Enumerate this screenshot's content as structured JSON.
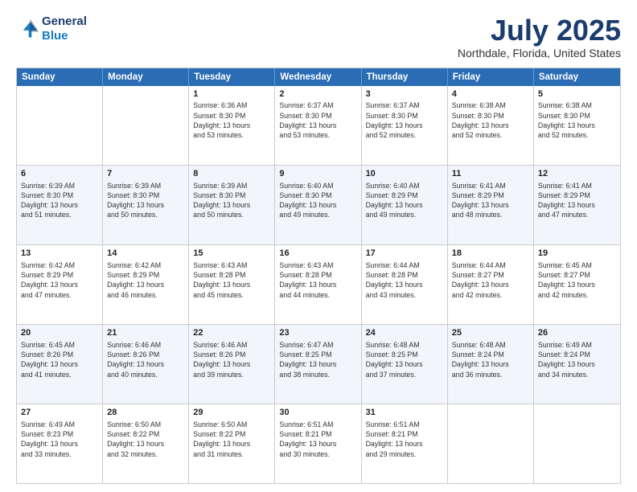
{
  "logo": {
    "line1": "General",
    "line2": "Blue"
  },
  "title": "July 2025",
  "location": "Northdale, Florida, United States",
  "weekdays": [
    "Sunday",
    "Monday",
    "Tuesday",
    "Wednesday",
    "Thursday",
    "Friday",
    "Saturday"
  ],
  "rows": [
    [
      {
        "day": "",
        "info": ""
      },
      {
        "day": "",
        "info": ""
      },
      {
        "day": "1",
        "info": "Sunrise: 6:36 AM\nSunset: 8:30 PM\nDaylight: 13 hours\nand 53 minutes."
      },
      {
        "day": "2",
        "info": "Sunrise: 6:37 AM\nSunset: 8:30 PM\nDaylight: 13 hours\nand 53 minutes."
      },
      {
        "day": "3",
        "info": "Sunrise: 6:37 AM\nSunset: 8:30 PM\nDaylight: 13 hours\nand 52 minutes."
      },
      {
        "day": "4",
        "info": "Sunrise: 6:38 AM\nSunset: 8:30 PM\nDaylight: 13 hours\nand 52 minutes."
      },
      {
        "day": "5",
        "info": "Sunrise: 6:38 AM\nSunset: 8:30 PM\nDaylight: 13 hours\nand 52 minutes."
      }
    ],
    [
      {
        "day": "6",
        "info": "Sunrise: 6:39 AM\nSunset: 8:30 PM\nDaylight: 13 hours\nand 51 minutes."
      },
      {
        "day": "7",
        "info": "Sunrise: 6:39 AM\nSunset: 8:30 PM\nDaylight: 13 hours\nand 50 minutes."
      },
      {
        "day": "8",
        "info": "Sunrise: 6:39 AM\nSunset: 8:30 PM\nDaylight: 13 hours\nand 50 minutes."
      },
      {
        "day": "9",
        "info": "Sunrise: 6:40 AM\nSunset: 8:30 PM\nDaylight: 13 hours\nand 49 minutes."
      },
      {
        "day": "10",
        "info": "Sunrise: 6:40 AM\nSunset: 8:29 PM\nDaylight: 13 hours\nand 49 minutes."
      },
      {
        "day": "11",
        "info": "Sunrise: 6:41 AM\nSunset: 8:29 PM\nDaylight: 13 hours\nand 48 minutes."
      },
      {
        "day": "12",
        "info": "Sunrise: 6:41 AM\nSunset: 8:29 PM\nDaylight: 13 hours\nand 47 minutes."
      }
    ],
    [
      {
        "day": "13",
        "info": "Sunrise: 6:42 AM\nSunset: 8:29 PM\nDaylight: 13 hours\nand 47 minutes."
      },
      {
        "day": "14",
        "info": "Sunrise: 6:42 AM\nSunset: 8:29 PM\nDaylight: 13 hours\nand 46 minutes."
      },
      {
        "day": "15",
        "info": "Sunrise: 6:43 AM\nSunset: 8:28 PM\nDaylight: 13 hours\nand 45 minutes."
      },
      {
        "day": "16",
        "info": "Sunrise: 6:43 AM\nSunset: 8:28 PM\nDaylight: 13 hours\nand 44 minutes."
      },
      {
        "day": "17",
        "info": "Sunrise: 6:44 AM\nSunset: 8:28 PM\nDaylight: 13 hours\nand 43 minutes."
      },
      {
        "day": "18",
        "info": "Sunrise: 6:44 AM\nSunset: 8:27 PM\nDaylight: 13 hours\nand 42 minutes."
      },
      {
        "day": "19",
        "info": "Sunrise: 6:45 AM\nSunset: 8:27 PM\nDaylight: 13 hours\nand 42 minutes."
      }
    ],
    [
      {
        "day": "20",
        "info": "Sunrise: 6:45 AM\nSunset: 8:26 PM\nDaylight: 13 hours\nand 41 minutes."
      },
      {
        "day": "21",
        "info": "Sunrise: 6:46 AM\nSunset: 8:26 PM\nDaylight: 13 hours\nand 40 minutes."
      },
      {
        "day": "22",
        "info": "Sunrise: 6:46 AM\nSunset: 8:26 PM\nDaylight: 13 hours\nand 39 minutes."
      },
      {
        "day": "23",
        "info": "Sunrise: 6:47 AM\nSunset: 8:25 PM\nDaylight: 13 hours\nand 38 minutes."
      },
      {
        "day": "24",
        "info": "Sunrise: 6:48 AM\nSunset: 8:25 PM\nDaylight: 13 hours\nand 37 minutes."
      },
      {
        "day": "25",
        "info": "Sunrise: 6:48 AM\nSunset: 8:24 PM\nDaylight: 13 hours\nand 36 minutes."
      },
      {
        "day": "26",
        "info": "Sunrise: 6:49 AM\nSunset: 8:24 PM\nDaylight: 13 hours\nand 34 minutes."
      }
    ],
    [
      {
        "day": "27",
        "info": "Sunrise: 6:49 AM\nSunset: 8:23 PM\nDaylight: 13 hours\nand 33 minutes."
      },
      {
        "day": "28",
        "info": "Sunrise: 6:50 AM\nSunset: 8:22 PM\nDaylight: 13 hours\nand 32 minutes."
      },
      {
        "day": "29",
        "info": "Sunrise: 6:50 AM\nSunset: 8:22 PM\nDaylight: 13 hours\nand 31 minutes."
      },
      {
        "day": "30",
        "info": "Sunrise: 6:51 AM\nSunset: 8:21 PM\nDaylight: 13 hours\nand 30 minutes."
      },
      {
        "day": "31",
        "info": "Sunrise: 6:51 AM\nSunset: 8:21 PM\nDaylight: 13 hours\nand 29 minutes."
      },
      {
        "day": "",
        "info": ""
      },
      {
        "day": "",
        "info": ""
      }
    ]
  ]
}
